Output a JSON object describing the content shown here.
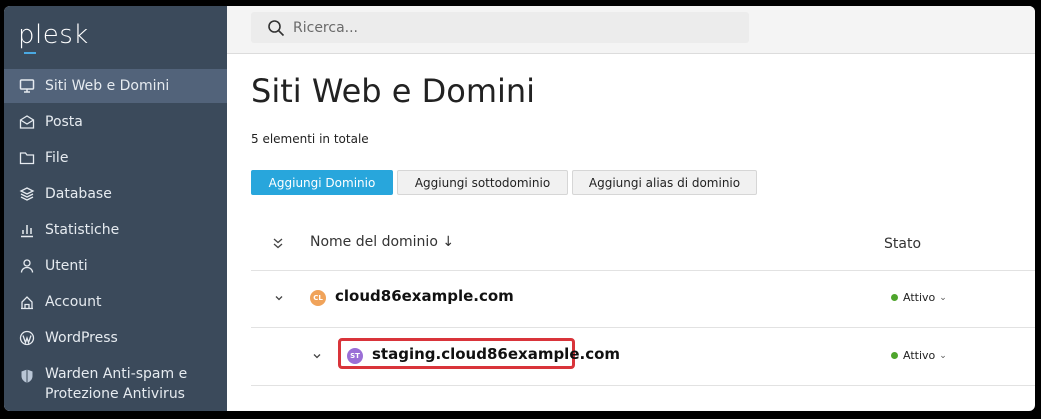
{
  "app": {
    "logo": "plesk"
  },
  "sidebar": {
    "items": [
      {
        "label": "Siti Web e Domini",
        "icon": "monitor-icon",
        "active": true
      },
      {
        "label": "Posta",
        "icon": "mail-icon"
      },
      {
        "label": "File",
        "icon": "folder-icon"
      },
      {
        "label": "Database",
        "icon": "database-icon"
      },
      {
        "label": "Statistiche",
        "icon": "bar-chart-icon"
      },
      {
        "label": "Utenti",
        "icon": "user-icon"
      },
      {
        "label": "Account",
        "icon": "account-icon"
      },
      {
        "label": "WordPress",
        "icon": "wordpress-icon"
      },
      {
        "label_line1": "Warden Anti-spam e",
        "label_line2": "Protezione Antivirus",
        "icon": "shield-icon"
      }
    ]
  },
  "search": {
    "placeholder": "Ricerca..."
  },
  "page": {
    "title": "Siti Web e Domini",
    "count": "5 elementi in totale"
  },
  "toolbar": {
    "add_domain": "Aggiungi Dominio",
    "add_subdomain": "Aggiungi sottodominio",
    "add_alias": "Aggiungi alias di dominio"
  },
  "table": {
    "col_name": "Nome del dominio ↓",
    "col_state": "Stato",
    "rows": [
      {
        "badge": "CL",
        "badge_color": "#f0a35a",
        "name": "cloud86example.com",
        "status": "Attivo"
      },
      {
        "badge": "ST",
        "badge_color": "#9b6fd6",
        "name": "staging.cloud86example.com",
        "status": "Attivo",
        "highlighted": true
      }
    ]
  },
  "colors": {
    "accent": "#28a6dc",
    "sidebar": "#3b4a5b",
    "active_status": "#4ea52c",
    "highlight": "#d9343a"
  }
}
